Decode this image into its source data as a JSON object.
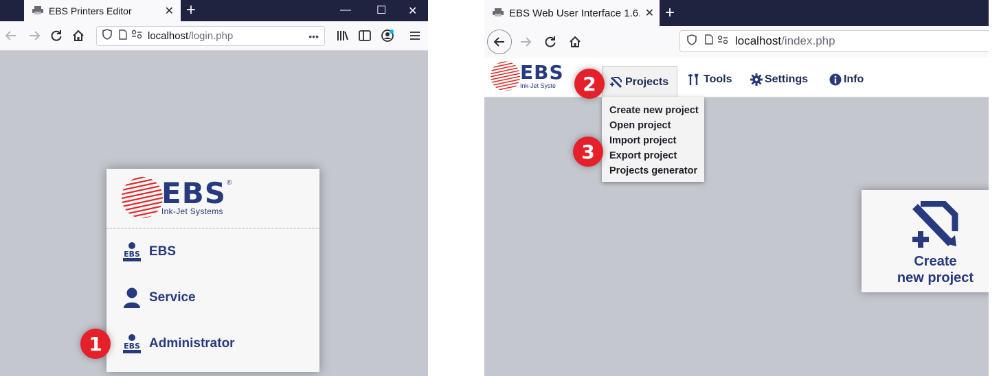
{
  "left_window": {
    "tab": {
      "title": "EBS Printers Editor",
      "close": "✕"
    },
    "new_tab": "+",
    "window_controls": {
      "minimize": "—",
      "maximize": "☐",
      "close": "✕"
    },
    "url": {
      "host": "localhost",
      "path": "/login.php",
      "more": "•••"
    },
    "logo": {
      "word": "EBS",
      "registered": "®",
      "tagline": "Ink-Jet Systems"
    },
    "login_options": [
      {
        "label": "EBS",
        "icon": "ebs-user-icon"
      },
      {
        "label": "Service",
        "icon": "person-icon"
      },
      {
        "label": "Administrator",
        "icon": "ebs-user-icon"
      }
    ],
    "step_badge": "1"
  },
  "right_window": {
    "tab": {
      "title": "EBS Web User Interface 1.6.",
      "close": "✕"
    },
    "new_tab": "+",
    "url": {
      "host": "localhost",
      "path": "/index.php"
    },
    "logo": {
      "word": "EBS",
      "tagline": "Ink-Jet Syste"
    },
    "menu": [
      {
        "label": "Projects",
        "icon": "projects-icon",
        "active": true
      },
      {
        "label": "Tools",
        "icon": "tools-icon"
      },
      {
        "label": "Settings",
        "icon": "gear-icon"
      },
      {
        "label": "Info",
        "icon": "info-icon"
      }
    ],
    "dropdown": [
      "Create new project",
      "Open project",
      "Import project",
      "Export project",
      "Projects generator"
    ],
    "tile": {
      "line1": "Create",
      "line2": "new project",
      "icon": "create-project-icon"
    },
    "step_badges": [
      "2",
      "3"
    ]
  },
  "colors": {
    "brand_blue": "#263a7d",
    "badge_red": "#e5202a",
    "tab_bar": "#202340",
    "workspace": "#c5c7cf"
  }
}
